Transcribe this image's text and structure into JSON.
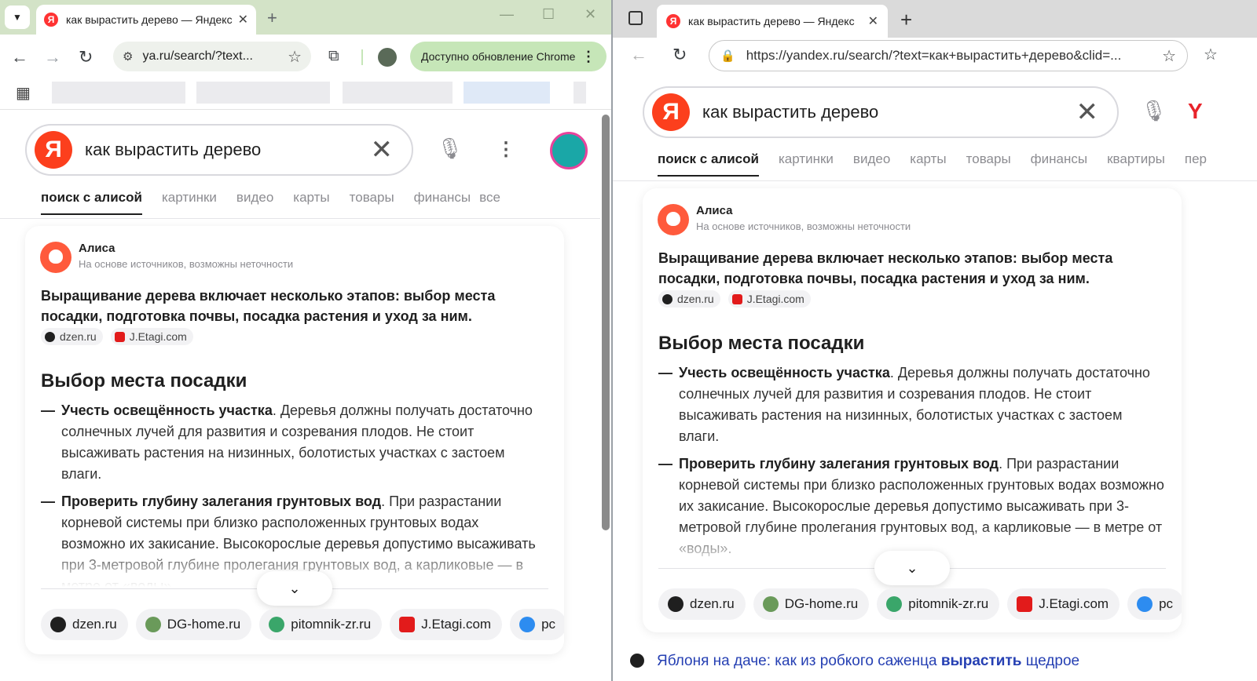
{
  "left": {
    "tab_title": "как вырастить дерево — Яндекс",
    "url": "ya.ru/search/?text...",
    "update_button": "Доступно обновление Chrome"
  },
  "right": {
    "tab_title": "как вырастить дерево — Яндекс",
    "url": "https://yandex.ru/search/?text=как+вырастить+дерево&clid=..."
  },
  "search": {
    "query": "как вырастить дерево",
    "logo": "Я"
  },
  "tabs_left": [
    "поиск с алисой",
    "картинки",
    "видео",
    "карты",
    "товары",
    "финансы",
    "все"
  ],
  "tabs_right": [
    "поиск с алисой",
    "картинки",
    "видео",
    "карты",
    "товары",
    "финансы",
    "квартиры",
    "пер"
  ],
  "answer": {
    "author": "Алиса",
    "disclaimer": "На основе источников, возможны неточности",
    "lead": "Выращивание дерева включает несколько этапов: выбор места посадки, подготовка почвы, посадка растения и уход за ним.",
    "lead_sources": [
      {
        "label": "dzen.ru",
        "color": "#1f1f1f"
      },
      {
        "label": "J.Etagi.com",
        "color": "#e21b1b"
      }
    ],
    "heading": "Выбор места посадки",
    "items": [
      {
        "dash": "—",
        "title": "Учесть освещённость участка",
        "text": ". Деревья должны получать достаточно солнечных лучей для развития и созревания плодов. Не стоит высаживать растения на низинных, болотистых участках с застоем влаги."
      },
      {
        "dash": "—",
        "title": "Проверить глубину залегания грунтовых вод",
        "text": ". При разрастании корневой системы при близко расположенных грунтовых водах возможно их закисание. Высокорослые деревья допустимо высаживать при 3-метровой глубине пролегания грунтовых вод, а карликовые — в метре от «воды»."
      }
    ],
    "sources": [
      {
        "label": "dzen.ru",
        "color": "#1f1f1f"
      },
      {
        "label": "DG-home.ru",
        "color": "#6a9a5a"
      },
      {
        "label": "pitomnik-zr.ru",
        "color": "#3aa66a"
      },
      {
        "label": "J.Etagi.com",
        "color": "#e21b1b"
      },
      {
        "label": "pc",
        "color": "#2d8cf0"
      }
    ]
  },
  "result_right": {
    "prefix": "Яблоня на даче: как из робкого саженца ",
    "highlight": "вырастить",
    "suffix": " щедрое"
  },
  "colors": {
    "accent": "#fc3f1d",
    "chrome_frame": "#d3e3c7",
    "edge_frame": "#dadada"
  }
}
